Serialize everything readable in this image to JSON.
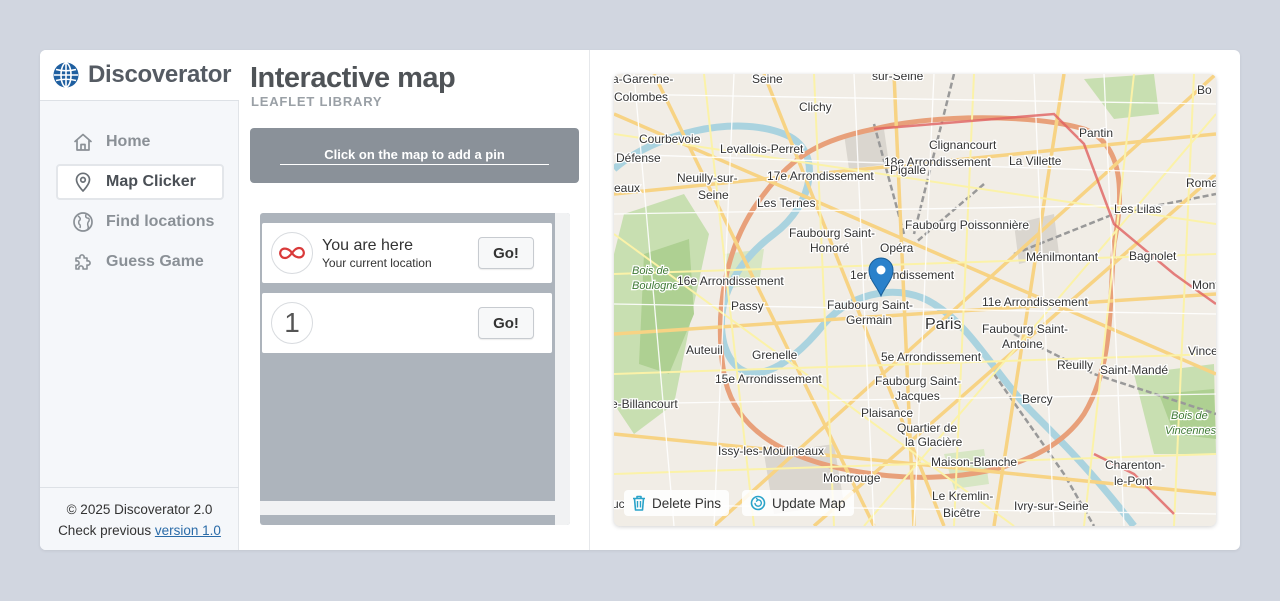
{
  "brand": {
    "title": "Discoverator",
    "icon": "globe-icon",
    "accent": "#1f5fa0"
  },
  "nav": [
    {
      "label": "Home",
      "icon": "home-icon",
      "active": false
    },
    {
      "label": "Map Clicker",
      "icon": "map-pin-icon",
      "active": true
    },
    {
      "label": "Find locations",
      "icon": "globe-icon",
      "active": false
    },
    {
      "label": "Guess Game",
      "icon": "puzzle-icon",
      "active": false
    }
  ],
  "footer": {
    "copyright": "© 2025 Discoverator 2.0",
    "previous_prefix": "Check previous",
    "previous_link": "version 1.0"
  },
  "header": {
    "title": "Interactive map",
    "subtitle": "LEAFLET LIBRARY"
  },
  "hint": "Click on the map to add a pin",
  "locations": [
    {
      "badge": "∞",
      "title": "You are here",
      "subtitle": "Your current location",
      "button": "Go!"
    },
    {
      "badge": "1",
      "title": "",
      "subtitle": "",
      "button": "Go!"
    }
  ],
  "map": {
    "labels": [
      "a-Garenne-",
      "Colombes",
      "Seine",
      "sur-Seine",
      "Bo",
      "Clichy",
      "Pantin",
      "Courbevoie",
      "Clignancourt",
      "Levallois-Perret",
      "18e Arrondissement",
      "La Villette",
      "Défense",
      "17e Arrondissement",
      "Neuilly-sur-",
      "Seine",
      "Pigalle",
      "Romainv",
      "eaux",
      "Les Lilas",
      "Les Ternes",
      "Faubourg Poissonnière",
      "Faubourg Saint-",
      "Honoré",
      "Opéra",
      "Bois de",
      "Boulogne",
      "1er Arrondissement",
      "Ménilmontant",
      "Bagnolet",
      "16e Arrondissement",
      "Mont",
      "Passy",
      "Faubourg Saint-",
      "Germain",
      "11e Arrondissement",
      "Paris",
      "Faubourg Saint-",
      "Antoine",
      "Auteuil",
      "Grenelle",
      "5e Arrondissement",
      "Vincen",
      "Reuilly",
      "Saint-Mandé",
      "15e Arrondissement",
      "Faubourg Saint-",
      "Jacques",
      "e-Billancourt",
      "Bercy",
      "Plaisance",
      "Quartier de",
      "la Glacière",
      "Bois de",
      "Vincennes",
      "Issy-les-Moulineaux",
      "Maison-Blanche",
      "Charenton-",
      "le-Pont",
      "Montrouge",
      "Le Kremlin-",
      "Bicêtre",
      "Ivry-sur-Seine",
      "uc"
    ],
    "delete_label": "Delete Pins",
    "update_label": "Update Map",
    "pin_color": "#2a81cb"
  }
}
